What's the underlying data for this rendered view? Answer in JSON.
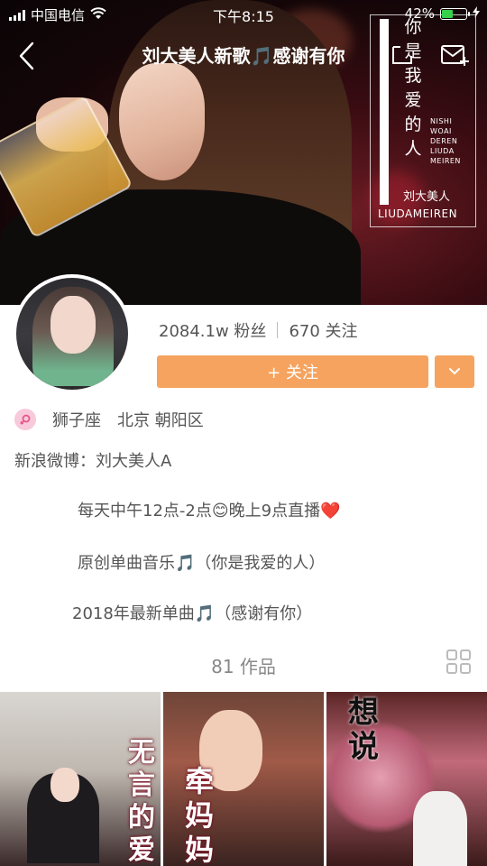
{
  "status_bar": {
    "carrier": "中国电信",
    "time": "下午8:15",
    "battery": "42%",
    "battery_level": 0.42
  },
  "nav": {
    "title": "刘大美人新歌🎵感谢有你"
  },
  "cover_poster": {
    "vertical_title": [
      "你",
      "是",
      "我",
      "爱",
      "的",
      "人"
    ],
    "pinyin": [
      "NISHI",
      "WOAI",
      "DEREN",
      "LIUDA",
      "MEIREN"
    ],
    "artist_cn": "刘大美人",
    "artist_en": "LIUDAMEIREN"
  },
  "profile": {
    "fans": "2084.1w 粉丝",
    "following": "670 关注",
    "follow_label": "+ 关注",
    "zodiac": "狮子座",
    "location": "北京 朝阳区",
    "weibo": "新浪微博：刘大美人A",
    "bio": [
      "每天中午12点-2点😊晚上9点直播❤️",
      "原创单曲音乐🎵（你是我爱的人）",
      "2018年最新单曲🎵（感谢有你）"
    ]
  },
  "works": {
    "count_label": "81 作品",
    "thumbnails": [
      {
        "caption": "无言的爱"
      },
      {
        "caption": "牵妈妈"
      },
      {
        "caption": "想说"
      }
    ]
  },
  "colors": {
    "accent": "#f5a35f",
    "text": "#555555",
    "muted": "#888888",
    "gender_badge": "#f7c9db"
  }
}
